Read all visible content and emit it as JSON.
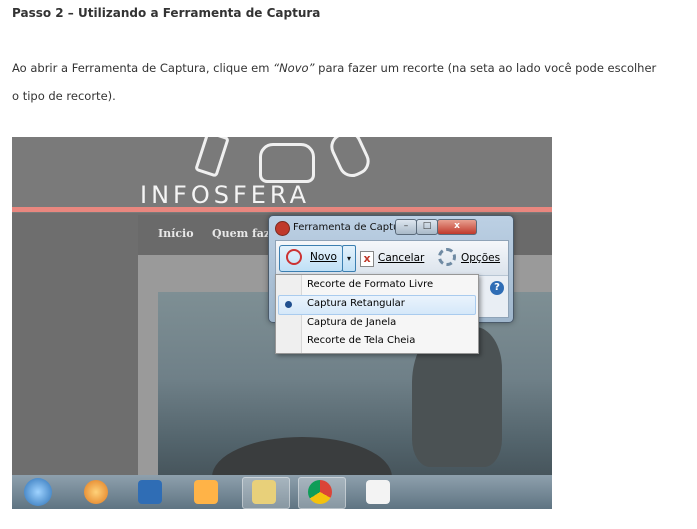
{
  "article": {
    "heading": "Passo 2 – Utilizando a Ferramenta de Captura",
    "para_line1_a": "Ao abrir a Ferramenta de Captura, clique em ",
    "para_line1_em": "“Novo”",
    "para_line1_b": " para fazer um recorte (na seta ao lado você pode escolher",
    "para_line2": "o tipo de recorte)."
  },
  "screenshot": {
    "logo_text": "INFOSFERA",
    "nav": {
      "inicio": "Início",
      "quem": "Quem faz"
    },
    "snipping_tool": {
      "title": "Ferramenta de Captura",
      "new_label": "Novo",
      "cancel_label": "Cancelar",
      "options_label": "Opções",
      "menu_items": [
        "Recorte de Formato Livre",
        "Captura Retangular",
        "Captura de Janela",
        "Recorte de Tela Cheia"
      ],
      "selected_index": 1
    },
    "icons": {
      "close": "x",
      "help": "?",
      "cancel": "x",
      "dropdown": "▾"
    }
  }
}
